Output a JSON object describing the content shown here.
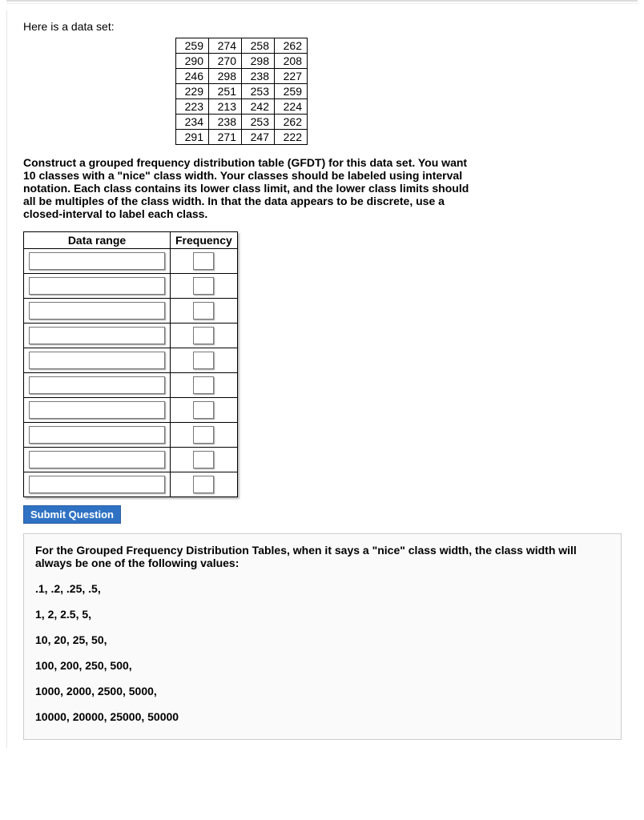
{
  "intro": "Here is a data set:",
  "dataset": [
    [
      259,
      274,
      258,
      262
    ],
    [
      290,
      270,
      298,
      208
    ],
    [
      246,
      298,
      238,
      227
    ],
    [
      229,
      251,
      253,
      259
    ],
    [
      223,
      213,
      242,
      224
    ],
    [
      234,
      238,
      253,
      262
    ],
    [
      291,
      271,
      247,
      222
    ]
  ],
  "prompt": "Construct a grouped frequency distribution table (GFDT) for this data set. You want 10 classes with a \"nice\" class width. Your classes should be labeled using interval notation. Each class contains its lower class limit, and the lower class limits should all be multiples of the class width. In that the data appears to be discrete, use a closed-interval to label each class.",
  "gfdt": {
    "headers": {
      "range": "Data range",
      "freq": "Frequency"
    },
    "rows": 10
  },
  "submit_label": "Submit Question",
  "hint": {
    "lead": "For the Grouped Frequency Distribution Tables, when it says a \"nice\" class width, the class width will always be one of the following values:",
    "lines": [
      ".1, .2, .25, .5,",
      "1, 2, 2.5, 5,",
      "10, 20, 25, 50,",
      "100, 200, 250, 500,",
      "1000, 2000, 2500, 5000,",
      "10000, 20000, 25000, 50000"
    ]
  }
}
